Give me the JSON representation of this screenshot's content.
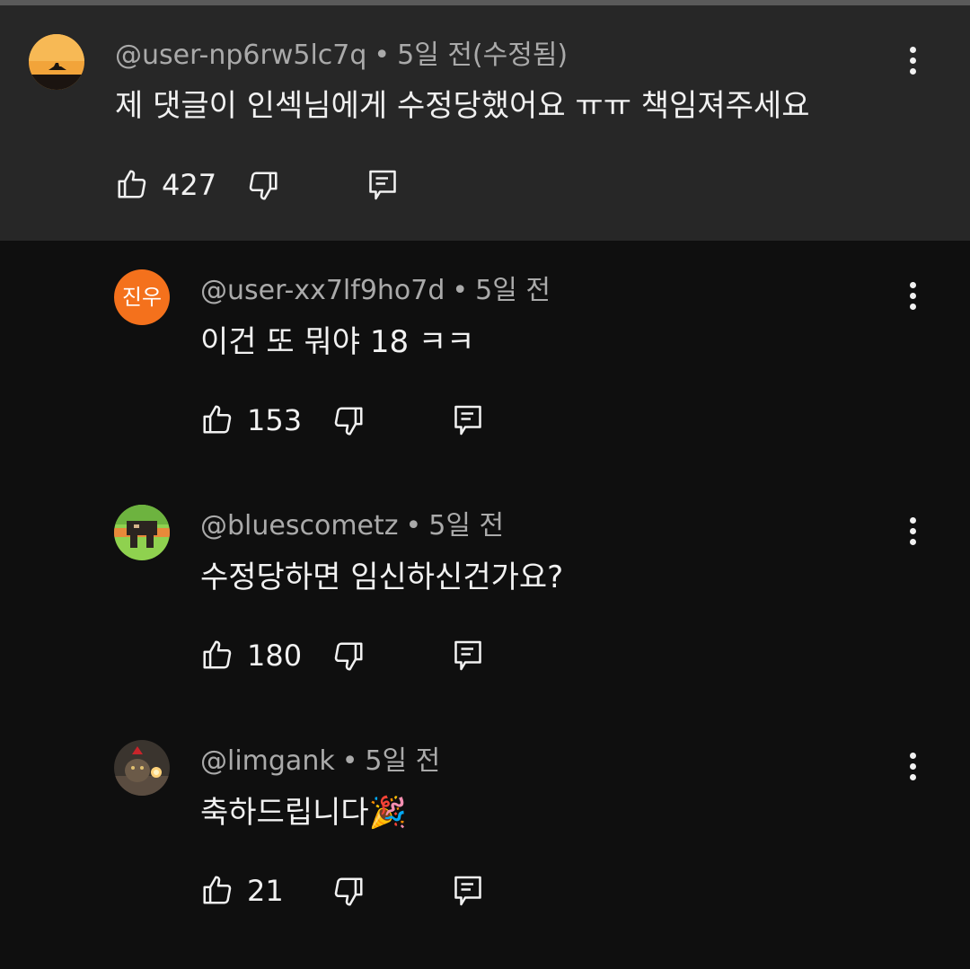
{
  "comments": [
    {
      "handle": "@user-np6rw5lc7q",
      "time": "5일 전(수정됨)",
      "text": "제 댓글이 인섹님에게 수정당했어요 ㅠㅠ 책임져주세요",
      "likes": "427",
      "avatar": "sunset-silhouette"
    },
    {
      "handle": "@user-xx7lf9ho7d",
      "time": "5일 전",
      "text": "이건 또 뭐야 18 ㅋㅋ",
      "likes": "153",
      "avatar_text": "진우",
      "avatar_color": "#f4711c"
    },
    {
      "handle": "@bluescometz",
      "time": "5일 전",
      "text": "수정당하면 임신하신건가요?",
      "likes": "180",
      "avatar": "pixel-character-green"
    },
    {
      "handle": "@limgank",
      "time": "5일 전",
      "text": "축하드립니다🎉",
      "likes": "21",
      "avatar": "cat-with-candle"
    }
  ],
  "separator": "•",
  "colors": {
    "background": "#0f0f0f",
    "highlight": "#272727",
    "text_primary": "#f1f1f1",
    "text_secondary": "#aaaaaa"
  }
}
